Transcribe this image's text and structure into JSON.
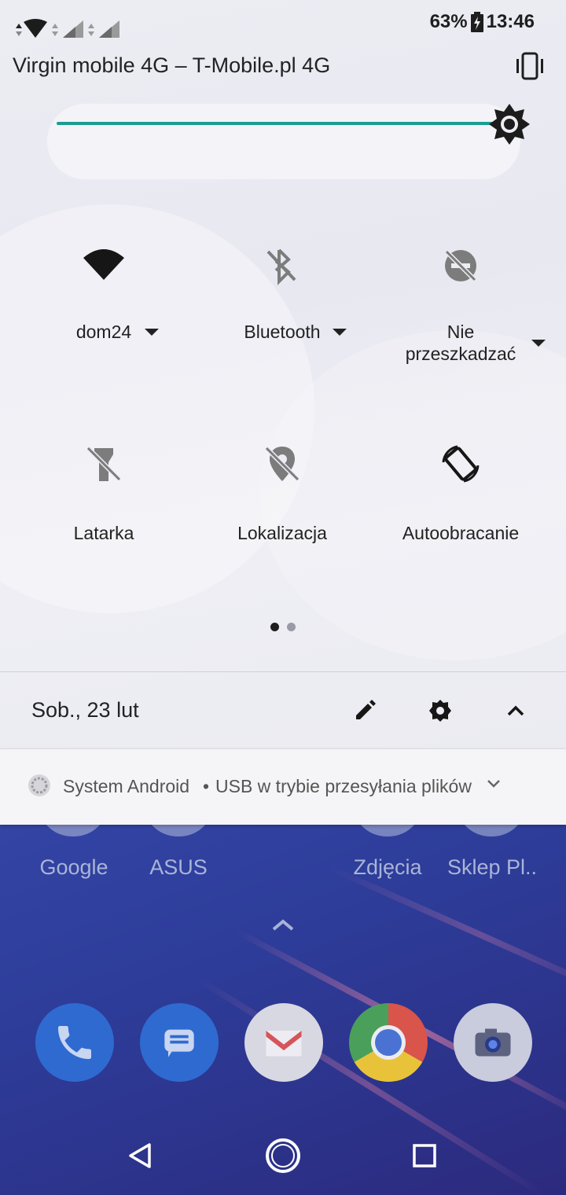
{
  "status_bar": {
    "battery": "63%",
    "time": "13:46"
  },
  "carrier": "Virgin mobile 4G – T-Mobile.pl 4G",
  "brightness": {
    "level": 1.0,
    "accent": "#1a9d8f"
  },
  "tiles": [
    {
      "label": "dom24",
      "icon": "wifi-icon",
      "active": true,
      "has_caret": true
    },
    {
      "label": "Bluetooth",
      "icon": "bluetooth-off-icon",
      "active": false,
      "has_caret": true
    },
    {
      "label": "Nie przeszkadzać",
      "icon": "do-not-disturb-off-icon",
      "active": false,
      "has_caret": true
    },
    {
      "label": "Latarka",
      "icon": "flashlight-off-icon",
      "active": false,
      "has_caret": false
    },
    {
      "label": "Lokalizacja",
      "icon": "location-off-icon",
      "active": false,
      "has_caret": false
    },
    {
      "label": "Autoobracanie",
      "icon": "auto-rotate-icon",
      "active": true,
      "has_caret": false
    }
  ],
  "pager": {
    "current": 1,
    "total": 2
  },
  "footer": {
    "date": "Sob., 23 lut",
    "icons": [
      "edit-icon",
      "settings-icon",
      "collapse-icon"
    ]
  },
  "notification": {
    "app": "System Android",
    "separator": "•",
    "text": "USB w trybie przesyłania plików"
  },
  "home": {
    "apps": [
      "Google",
      "ASUS",
      "Zdjęcia",
      "Sklep Pl.."
    ],
    "dock": [
      "phone-icon",
      "messages-icon",
      "gmail-icon",
      "chrome-icon",
      "camera-icon"
    ]
  },
  "navbar": [
    "back-icon",
    "home-icon",
    "recents-icon"
  ]
}
